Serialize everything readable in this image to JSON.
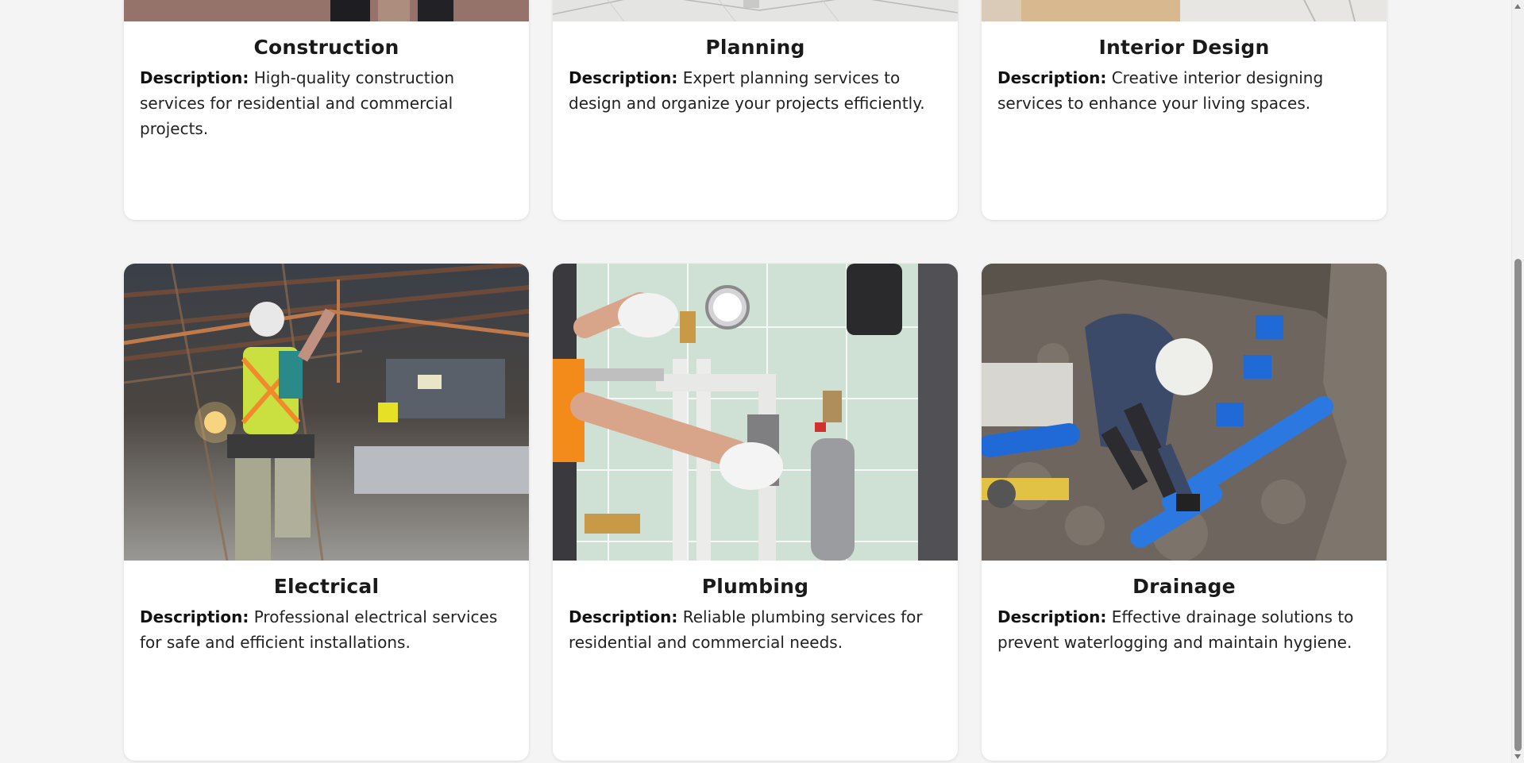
{
  "description_label": "Description:",
  "services": [
    {
      "title": "Construction",
      "description": "High-quality construction services for residential and commercial projects.",
      "image": "construction-photo"
    },
    {
      "title": "Planning",
      "description": "Expert planning services to design and organize your projects efficiently.",
      "image": "planning-photo"
    },
    {
      "title": "Interior Design",
      "description": "Creative interior designing services to enhance your living spaces.",
      "image": "interior-design-photo"
    },
    {
      "title": "Electrical",
      "description": "Professional electrical services for safe and efficient installations.",
      "image": "electrician-photo"
    },
    {
      "title": "Plumbing",
      "description": "Reliable plumbing services for residential and commercial needs.",
      "image": "plumbing-photo"
    },
    {
      "title": "Drainage",
      "description": "Effective drainage solutions to prevent waterlogging and maintain hygiene.",
      "image": "drainage-photo"
    }
  ],
  "colors": {
    "page_background": "#f4f4f4",
    "card_background": "#ffffff",
    "text": "#1a1a1a"
  }
}
